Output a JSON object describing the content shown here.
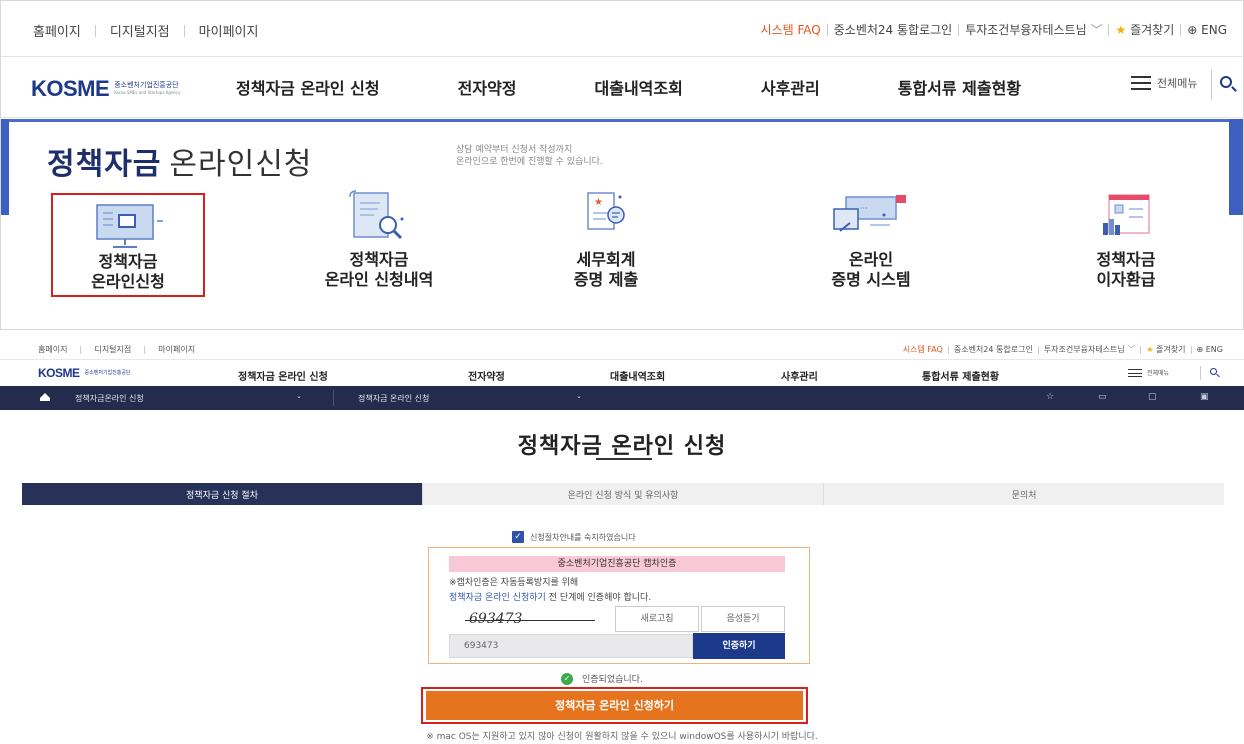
{
  "top": {
    "util_left": [
      "홈페이지",
      "디지털지점",
      "마이페이지"
    ],
    "util_right": {
      "faq": "시스템 FAQ",
      "login": "중소벤처24 통합로그인",
      "user": "투자조건부융자테스트님",
      "favorites": "즐겨찾기",
      "lang": "ENG"
    },
    "logo": {
      "mark": "KOSME",
      "org_kr": "중소벤처기업진흥공단",
      "org_en": "Korea SMEs and Startups Agency"
    },
    "menu": [
      "정책자금 온라인 신청",
      "전자약정",
      "대출내역조회",
      "사후관리",
      "통합서류 제출현황"
    ],
    "all_menu": "전체메뉴",
    "hero": {
      "title_bold": "정책자금",
      "title_light": "온라인신청",
      "desc1": "상담 예약부터 신청서 작성까지",
      "desc2": "온라인으로 한번에 진행할 수 있습니다."
    },
    "tiles": [
      {
        "line1": "정책자금",
        "line2": "온라인신청"
      },
      {
        "line1": "정책자금",
        "line2": "온라인 신청내역"
      },
      {
        "line1": "세무회계",
        "line2": "증명 제출"
      },
      {
        "line1": "온라인",
        "line2": "증명 시스템"
      },
      {
        "line1": "정책자금",
        "line2": "이자환급"
      }
    ]
  },
  "bottom": {
    "util_left": [
      "홈페이지",
      "디지털지점",
      "마이페이지"
    ],
    "util_right": {
      "faq": "시스템 FAQ",
      "login": "중소벤처24 통합로그인",
      "user": "투자조건부융자테스트님",
      "favorites": "즐겨찾기",
      "lang": "ENG"
    },
    "menu": [
      "정책자금 온라인 신청",
      "전자약정",
      "대출내역조회",
      "사후관리",
      "통합서류 제출현황"
    ],
    "all_menu": "전체메뉴",
    "breadcrumb": [
      "정책자금온라인 신청",
      "정책자금 온라인 신청"
    ],
    "page_title": "정책자금 온라인 신청",
    "tabs": [
      "정책자금 신청 절차",
      "온라인 신청 방식 및 유의사항",
      "문의처"
    ],
    "agree_text": "신청절차안내를 숙지하였습니다",
    "captcha": {
      "heading": "중소벤처기업진흥공단 캡차인증",
      "note1": "※캡차인증은 자동등록방지를 위해",
      "note2_link": "정책자금 온라인 신청하기",
      "note2_rest": " 전 단계에 인증해야 합니다.",
      "image_text": "693473",
      "refresh": "새로고침",
      "audio": "음성듣기",
      "input_value": "693473",
      "verify": "인증하기"
    },
    "verified": "인증되었습니다.",
    "apply_button": "정책자금 온라인 신청하기",
    "mac_note": "※ mac OS는 지원하고 있지 않아 신청이 원활하지 않을 수 있으니 windowOS를 사용하시기 바랍니다."
  },
  "colors": {
    "brand_navy": "#1d3a8a",
    "accent_orange": "#e6741e",
    "highlight_red": "#d62020"
  }
}
